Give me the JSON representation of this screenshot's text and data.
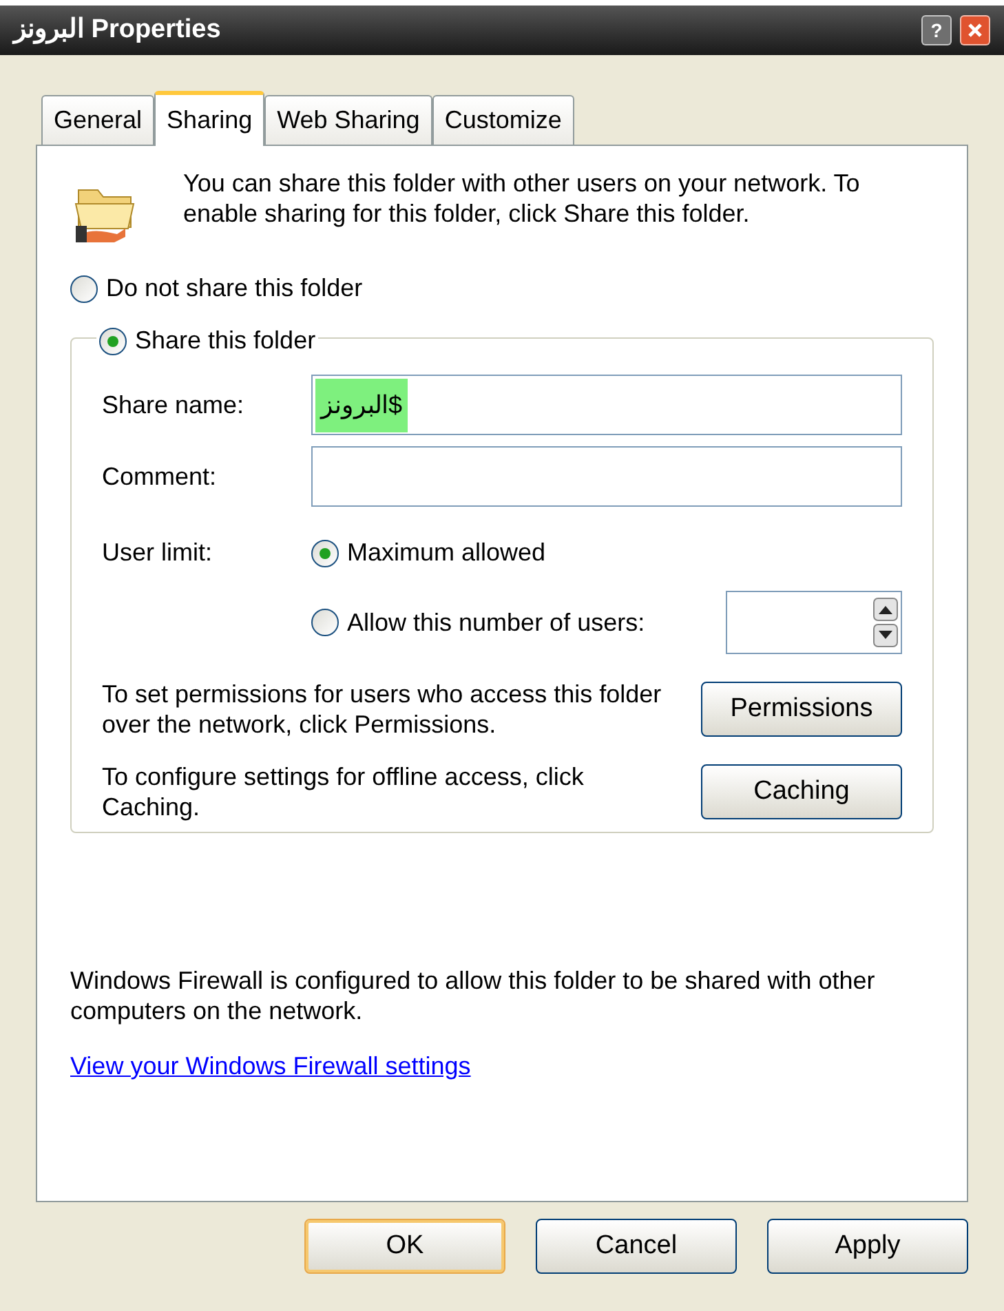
{
  "window": {
    "title": "البرونز Properties",
    "help_button": "?"
  },
  "tabs": [
    {
      "label": "General",
      "selected": false
    },
    {
      "label": "Sharing",
      "selected": true
    },
    {
      "label": "Web Sharing",
      "selected": false
    },
    {
      "label": "Customize",
      "selected": false
    }
  ],
  "intro": "You can share this folder with other users on your network.  To enable sharing for this folder, click Share this folder.",
  "share_options": [
    {
      "label": "Do not share this folder",
      "selected": false
    },
    {
      "label": "Share this folder",
      "selected": true
    }
  ],
  "fields": [
    {
      "label": "Share name:",
      "value": "البرونز$",
      "value_selected": true
    },
    {
      "label": "Comment:"
    }
  ],
  "user_limit": {
    "label": "User limit:",
    "options": [
      {
        "label": "Maximum allowed",
        "selected": true
      },
      {
        "label": "Allow this number of users:",
        "selected": false
      }
    ]
  },
  "actions": [
    {
      "text": "To set permissions for users who access this folder over the network, click Permissions.",
      "button": "Permissions"
    },
    {
      "text": "To configure settings for offline access, click Caching.",
      "button": "Caching"
    }
  ],
  "firewall": {
    "text": "Windows Firewall is configured to allow this folder to be shared with other computers on the network.",
    "link": "View your Windows Firewall settings"
  },
  "buttons": [
    {
      "label": "OK",
      "default": true
    },
    {
      "label": "Cancel",
      "default": false
    },
    {
      "label": "Apply",
      "default": false
    }
  ]
}
